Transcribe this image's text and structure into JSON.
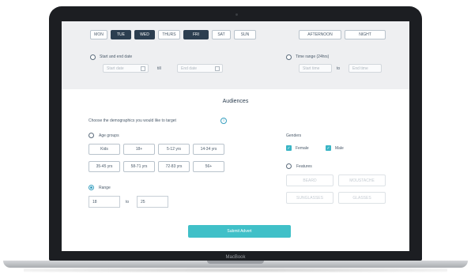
{
  "days": [
    "MON",
    "TUE",
    "WED",
    "THURS",
    "FRI",
    "SAT",
    "SUN"
  ],
  "active_days": [
    "TUE",
    "WED",
    "FRI"
  ],
  "times": [
    "AFTERNOON",
    "NIGHT"
  ],
  "date_range": {
    "label": "Start and end date",
    "start_placeholder": "Start date",
    "separator": "till",
    "end_placeholder": "End date"
  },
  "time_range": {
    "label": "Time range (24hrs)",
    "start_placeholder": "Start time",
    "separator": "to",
    "end_placeholder": "End time"
  },
  "audiences": {
    "title": "Audiences",
    "prompt": "Choose the demographics you would like to target",
    "info_glyph": "i",
    "age_groups_label": "Age groups",
    "age_groups": [
      "Kids",
      "18+",
      "5-12 yrs",
      "14-34 yrs",
      "35-45 yrs",
      "58-71 yrs",
      "72-83 yrs",
      "56+"
    ],
    "range_label": "Range",
    "range_min": "18",
    "range_separator": "to",
    "range_max": "25",
    "genders_label": "Genders",
    "genders": [
      "Female",
      "Male"
    ],
    "features_label": "Features",
    "features": [
      "BEARD",
      "MOUSTACHE",
      "SUNGLASSES",
      "GLASSES"
    ]
  },
  "submit_label": "Submit Advert",
  "device_brand": "MacBook",
  "colors": {
    "active_day": "#2c3e50",
    "accent": "#40c0c8",
    "checkbox": "#3ab5c5"
  }
}
